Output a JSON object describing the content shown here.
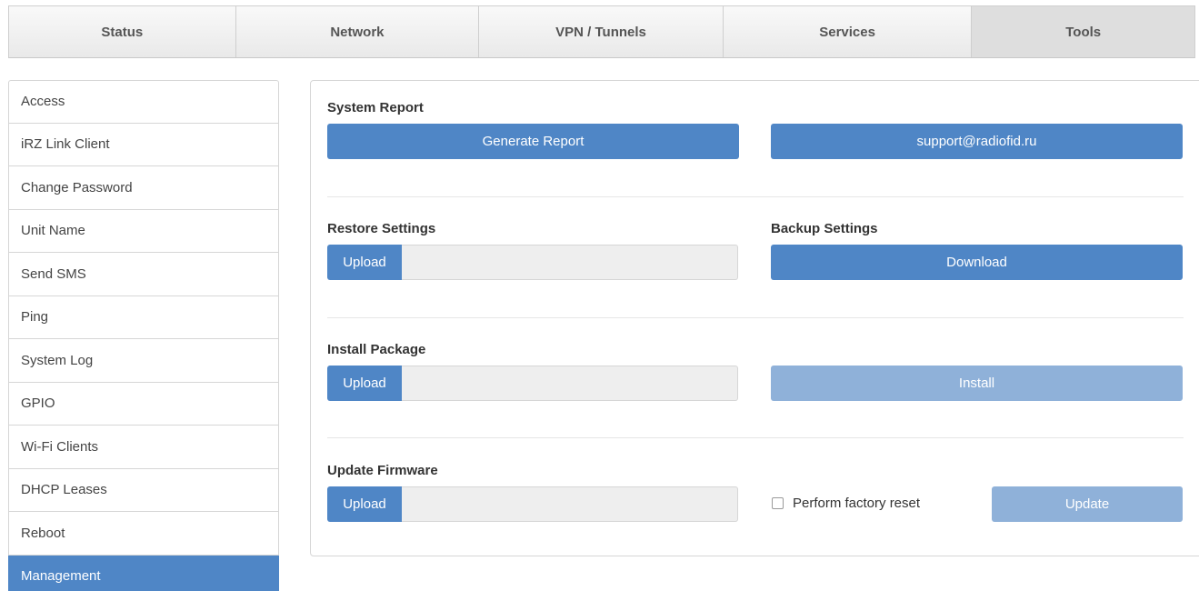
{
  "topnav": {
    "tabs": [
      {
        "label": "Status"
      },
      {
        "label": "Network"
      },
      {
        "label": "VPN / Tunnels"
      },
      {
        "label": "Services"
      },
      {
        "label": "Tools",
        "active": true
      }
    ]
  },
  "sidebar": {
    "items": [
      {
        "label": "Access"
      },
      {
        "label": "iRZ Link Client"
      },
      {
        "label": "Change Password"
      },
      {
        "label": "Unit Name"
      },
      {
        "label": "Send SMS"
      },
      {
        "label": "Ping"
      },
      {
        "label": "System Log"
      },
      {
        "label": "GPIO"
      },
      {
        "label": "Wi-Fi Clients"
      },
      {
        "label": "DHCP Leases"
      },
      {
        "label": "Reboot"
      },
      {
        "label": "Management",
        "active": true
      }
    ]
  },
  "main": {
    "system_report": {
      "title": "System Report",
      "generate_label": "Generate Report",
      "support_label": "support@radiofid.ru"
    },
    "restore": {
      "title": "Restore Settings",
      "upload_label": "Upload",
      "file_value": ""
    },
    "backup": {
      "title": "Backup Settings",
      "download_label": "Download"
    },
    "install_package": {
      "title": "Install Package",
      "upload_label": "Upload",
      "file_value": "",
      "install_label": "Install"
    },
    "update_firmware": {
      "title": "Update Firmware",
      "upload_label": "Upload",
      "file_value": "",
      "factory_reset_label": "Perform factory reset",
      "factory_reset_checked": false,
      "update_label": "Update"
    }
  },
  "colors": {
    "accent": "#4f86c6",
    "accent_disabled": "#8fb1d9",
    "field_bg": "#eeeeee"
  }
}
